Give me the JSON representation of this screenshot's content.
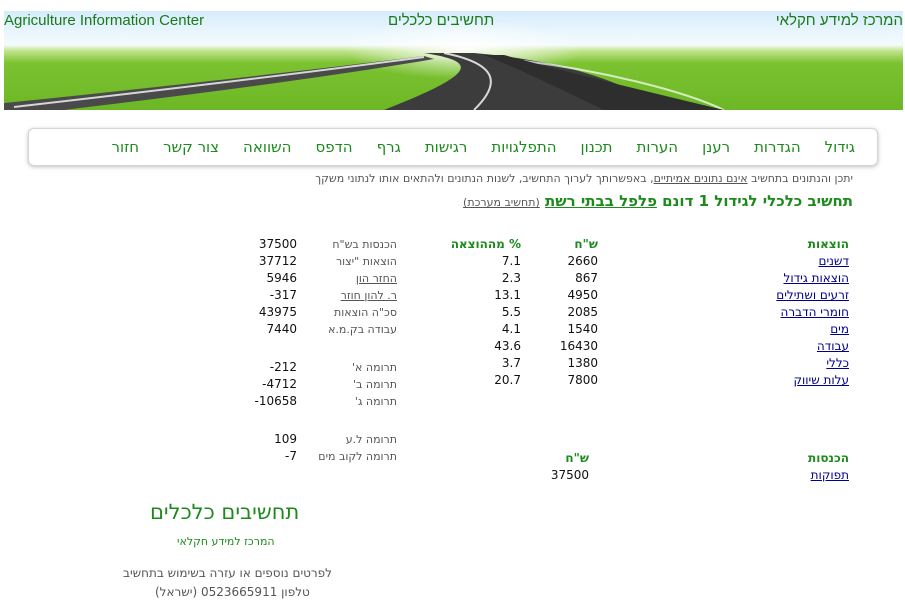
{
  "banner": {
    "left_title": "Agriculture Information Center",
    "center_title": "תחשיבים כלכלים",
    "right_title": "המרכז למידע חקלאי"
  },
  "nav": [
    "גידול",
    "הגדרות",
    "רענן",
    "הערות",
    "תכנון",
    "התפלגויות",
    "רגישות",
    "גרף",
    "הדפס",
    "השוואה",
    "צור קשר",
    "חזור"
  ],
  "notice": {
    "prefix": "יתכן והנתונים בתחשיב ",
    "link": "אינם נתונים אמיתיים",
    "suffix": ", באפשרותך לערוך התחשיב, לשנות הנתונים ולהתאים אותו לנתוני משקך"
  },
  "title": {
    "prefix": "תחשיב כלכלי לגידול 1 דונם ",
    "crop": "פלפל בבתי רשת",
    "system": "(תחשיב מערכת)"
  },
  "expenses": {
    "headers": {
      "item": "הוצאות",
      "nis": "ש\"ח",
      "pct": "% מההוצאה"
    },
    "rows": [
      {
        "item": "דשנים",
        "nis": "2660",
        "pct": "7.1"
      },
      {
        "item": "הוצאות גידול",
        "nis": "867",
        "pct": "2.3"
      },
      {
        "item": "זרעים ושתילים",
        "nis": "4950",
        "pct": "13.1"
      },
      {
        "item": "חומרי הדברה",
        "nis": "2085",
        "pct": "5.5"
      },
      {
        "item": "מים",
        "nis": "1540",
        "pct": "4.1"
      },
      {
        "item": "עבודה",
        "nis": "16430",
        "pct": "43.6"
      },
      {
        "item": "כללי",
        "nis": "1380",
        "pct": "3.7"
      },
      {
        "item": "עלות שיווק",
        "nis": "7800",
        "pct": "20.7"
      }
    ]
  },
  "summary": [
    {
      "label": "הכנסות בש\"ח",
      "value": "37500",
      "link": false
    },
    {
      "label": "הוצאות \"יצור",
      "value": "37712",
      "link": false
    },
    {
      "label": "החזר הון",
      "value": "5946",
      "link": true
    },
    {
      "label": "ר. להון חוזר",
      "value": "-317",
      "link": true
    },
    {
      "label": "סכ\"ה הוצאות",
      "value": "43975",
      "link": false
    },
    {
      "label": "עבודה בק.מ.א",
      "value": "7440",
      "link": false
    }
  ],
  "contributions": [
    {
      "label": "תרומה א'",
      "value": "-212"
    },
    {
      "label": "תרומה ב'",
      "value": "-4712"
    },
    {
      "label": "תרומה ג'",
      "value": "-10658"
    }
  ],
  "contributions2": [
    {
      "label": "תרומה ל.ע",
      "value": "109"
    },
    {
      "label": "תרומה לקוב מים",
      "value": "-7"
    }
  ],
  "income": {
    "headers": {
      "item": "הכנסות",
      "nis": "ש\"ח"
    },
    "rows": [
      {
        "item": "תפוקות",
        "nis": "37500"
      }
    ]
  },
  "footer": {
    "title": "תחשיבים כלכלים",
    "subtitle": "המרכז למידע חקלאי",
    "help": "לפרטים נוספים או עזרה בשימוש בתחשיב",
    "phone": "טלפון 0523665911 (ישראל)"
  }
}
